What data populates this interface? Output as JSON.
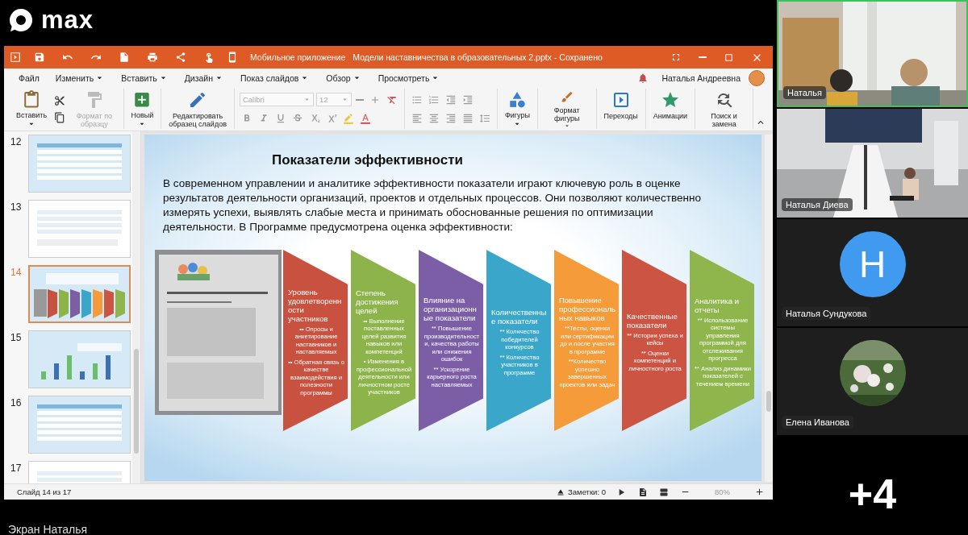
{
  "app": {
    "logo": "max"
  },
  "window": {
    "tooltip": "Мобильное приложение",
    "title": "Модели наставничества в образовательных 2.pptx - Сохранено"
  },
  "menu": [
    {
      "label": "Файл",
      "caret": false
    },
    {
      "label": "Изменить",
      "caret": true
    },
    {
      "label": "Вставить",
      "caret": true
    },
    {
      "label": "Дизайн",
      "caret": true
    },
    {
      "label": "Показ слайдов",
      "caret": true
    },
    {
      "label": "Обзор",
      "caret": true
    },
    {
      "label": "Просмотреть",
      "caret": true
    }
  ],
  "user": {
    "name": "Наталья Андреевна"
  },
  "ribbon": [
    {
      "items": [
        {
          "kind": "large",
          "label": "Вставить",
          "caret": true,
          "disabled": false
        },
        {
          "kind": "pair",
          "disabled": false
        },
        {
          "kind": "large",
          "label": "Формат по образцу",
          "caret": false,
          "disabled": true
        }
      ]
    },
    {
      "items": [
        {
          "kind": "large",
          "label": "Новый",
          "caret": true,
          "disabled": false
        }
      ]
    },
    {
      "items": [
        {
          "kind": "large",
          "label": "Редактировать образец слайдов",
          "caret": false,
          "disabled": false
        }
      ]
    },
    {
      "items": [
        {
          "kind": "font",
          "font": "Calibri",
          "size": "12",
          "disabled": true
        }
      ]
    },
    {
      "items": [
        {
          "kind": "paragraph",
          "disabled": true
        }
      ]
    },
    {
      "items": [
        {
          "kind": "large",
          "label": "Фигуры",
          "caret": true,
          "disabled": false
        }
      ]
    },
    {
      "items": [
        {
          "kind": "large",
          "label": "Формат фигуры",
          "caret": true,
          "disabled": false
        }
      ]
    },
    {
      "items": [
        {
          "kind": "large",
          "label": "Переходы",
          "caret": false,
          "disabled": false
        }
      ]
    },
    {
      "items": [
        {
          "kind": "large",
          "label": "Анимации",
          "caret": false,
          "disabled": false
        }
      ]
    },
    {
      "items": [
        {
          "kind": "large",
          "label": "Поиск и замена",
          "caret": false,
          "disabled": false
        }
      ]
    }
  ],
  "slides": [
    {
      "number": "12",
      "selected": false
    },
    {
      "number": "13",
      "selected": false
    },
    {
      "number": "14",
      "selected": true
    },
    {
      "number": "15",
      "selected": false
    },
    {
      "number": "16",
      "selected": false
    },
    {
      "number": "17",
      "selected": false
    }
  ],
  "slide": {
    "title": "Показатели эффективности",
    "text": "В современном управлении и аналитике эффективности показатели играют ключевую роль в оценке результатов деятельности организаций, проектов и отдельных процессов. Они позволяют количественно измерять успехи, выявлять слабые места и принимать обоснованные решения по оптимизации деятельности. В Программе предусмотрена оценка эффективности:",
    "indicators": [
      {
        "title": "Уровень удовлетворенности участников",
        "color": "#c8523f",
        "bullets": [
          "•• Опросы и анкетирование наставников и наставляемых",
          "•• Обратная связь о качестве взаимодействия и полезности программы"
        ]
      },
      {
        "title": "Степень достижения целей",
        "color": "#8db34b",
        "bullets": [
          "•• Выполнение поставленных целей развития навыков или компетенций",
          "• Изменения в профессиональной деятельности или личностном росте участников"
        ]
      },
      {
        "title": "Влияние на организационные показатели",
        "color": "#7b5ea6",
        "bullets": [
          "** Повышение производительности, качества работы или снижения ошибок",
          "** Ускорение карьерного роста наставляемых"
        ]
      },
      {
        "title": "Количественные показатели",
        "color": "#3aa6c9",
        "bullets": [
          "** Количество победителей конкурсов",
          "** Количество участников в программе"
        ]
      },
      {
        "title": "Повышение профессиональных навыков",
        "color": "#f59b3a",
        "bullets": [
          "**Тесты, оценки или сертификации до и после участия в программе",
          "**Количество успешно завершенных проектов или задач"
        ]
      },
      {
        "title": "Качественные показатели",
        "color": "#cc5443",
        "bullets": [
          "** Истории успеха и кейсы",
          "** Оценки компетенций и личностного роста"
        ]
      },
      {
        "title": "Аналитика и отчеты",
        "color": "#8fb64c",
        "bullets": [
          "** Использование системы управления программой для отслеживания прогресса",
          "** Анализ динамики показателей с течением времени"
        ]
      }
    ]
  },
  "status_bar": {
    "position": "Слайд 14 из 17",
    "notes": "Заметки: 0",
    "zoom": "80%"
  },
  "participants": [
    {
      "name": "Наталья",
      "kind": "video",
      "speaking": true
    },
    {
      "name": "Наталья Диева",
      "kind": "room",
      "speaking": false
    },
    {
      "name": "Наталья Сундукова",
      "kind": "letter",
      "letter": "Н",
      "speaking": false
    },
    {
      "name": "Елена Иванова",
      "speaking": false
    }
  ],
  "more_participants": "+4",
  "caption": "Экран Наталья"
}
